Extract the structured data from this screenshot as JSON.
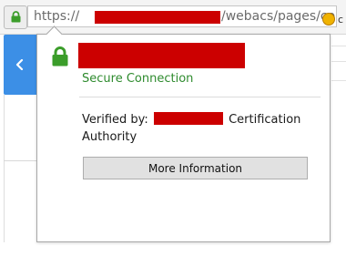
{
  "url_bar": {
    "url_prefix": "https://",
    "url_suffix": "/webacs/pages/common/login",
    "extension_label": "c"
  },
  "identity_panel": {
    "status_text": "Secure Connection",
    "verified_by_label": "Verified by:",
    "issuer_suffix": "Certification",
    "issuer_line2": "Authority",
    "more_info_label": "More Information"
  },
  "colors": {
    "secure_green": "#2e8b2e",
    "lock_green": "#3b9d2a",
    "redaction_red": "#cc0000",
    "back_tab_blue": "#3c8fe6"
  },
  "icons": {
    "site_identity": "lock-icon",
    "panel": "lock-icon",
    "back": "chevron-left-icon",
    "extension": "extension-icon"
  }
}
